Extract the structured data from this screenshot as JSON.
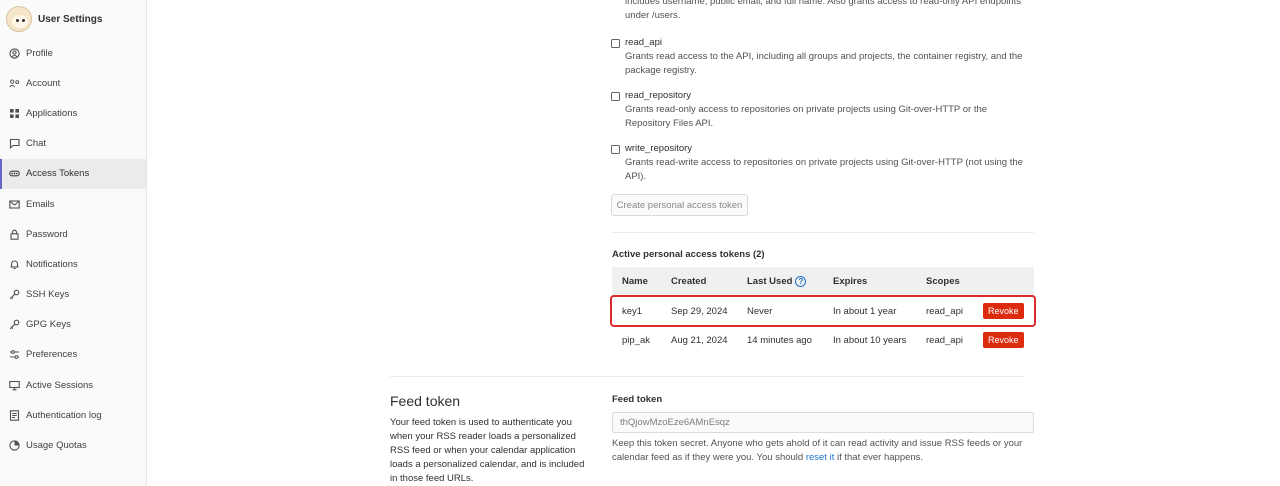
{
  "sidebar": {
    "title": "User Settings",
    "items": [
      {
        "label": "Profile",
        "icon": "profile-icon"
      },
      {
        "label": "Account",
        "icon": "account-icon"
      },
      {
        "label": "Applications",
        "icon": "applications-icon"
      },
      {
        "label": "Chat",
        "icon": "chat-icon"
      },
      {
        "label": "Access Tokens",
        "icon": "token-icon",
        "active": true
      },
      {
        "label": "Emails",
        "icon": "email-icon"
      },
      {
        "label": "Password",
        "icon": "lock-icon"
      },
      {
        "label": "Notifications",
        "icon": "bell-icon"
      },
      {
        "label": "SSH Keys",
        "icon": "key-icon"
      },
      {
        "label": "GPG Keys",
        "icon": "key-icon"
      },
      {
        "label": "Preferences",
        "icon": "preferences-icon"
      },
      {
        "label": "Active Sessions",
        "icon": "monitor-icon"
      },
      {
        "label": "Authentication log",
        "icon": "log-icon"
      },
      {
        "label": "Usage Quotas",
        "icon": "quota-icon"
      }
    ]
  },
  "scopes": {
    "read_user_tail": "includes username, public email, and full name. Also grants access to read-only API endpoints under /users.",
    "read_api": {
      "label": "read_api",
      "desc": "Grants read access to the API, including all groups and projects, the container registry, and the package registry."
    },
    "read_repository": {
      "label": "read_repository",
      "desc": "Grants read-only access to repositories on private projects using Git-over-HTTP or the Repository Files API."
    },
    "write_repository": {
      "label": "write_repository",
      "desc": "Grants read-write access to repositories on private projects using Git-over-HTTP (not using the API)."
    }
  },
  "create_button": "Create personal access token",
  "active_tokens": {
    "heading": "Active personal access tokens (2)",
    "columns": {
      "name": "Name",
      "created": "Created",
      "last_used": "Last Used",
      "expires": "Expires",
      "scopes": "Scopes"
    },
    "rows": [
      {
        "name": "key1",
        "created": "Sep 29, 2024",
        "last_used": "Never",
        "expires": "In about 1 year",
        "scopes": "read_api",
        "action": "Revoke"
      },
      {
        "name": "pip_ak",
        "created": "Aug 21, 2024",
        "last_used": "14 minutes ago",
        "expires": "In about 10 years",
        "scopes": "read_api",
        "action": "Revoke"
      }
    ]
  },
  "feed": {
    "title": "Feed token",
    "description": "Your feed token is used to authenticate you when your RSS reader loads a personalized RSS feed or when your calendar application loads a personalized calendar, and is included in those feed URLs.",
    "label": "Feed token",
    "value": "thQjowMzoEze6AMnEsqz",
    "help_before": "Keep this token secret. Anyone who gets ahold of it can read activity and issue RSS feeds or your calendar feed as if they were you. You should ",
    "help_link": "reset it",
    "help_after": " if that ever happens."
  },
  "colors": {
    "accent": "#6666c4",
    "danger": "#dd2b0e",
    "link": "#1f75cb"
  }
}
